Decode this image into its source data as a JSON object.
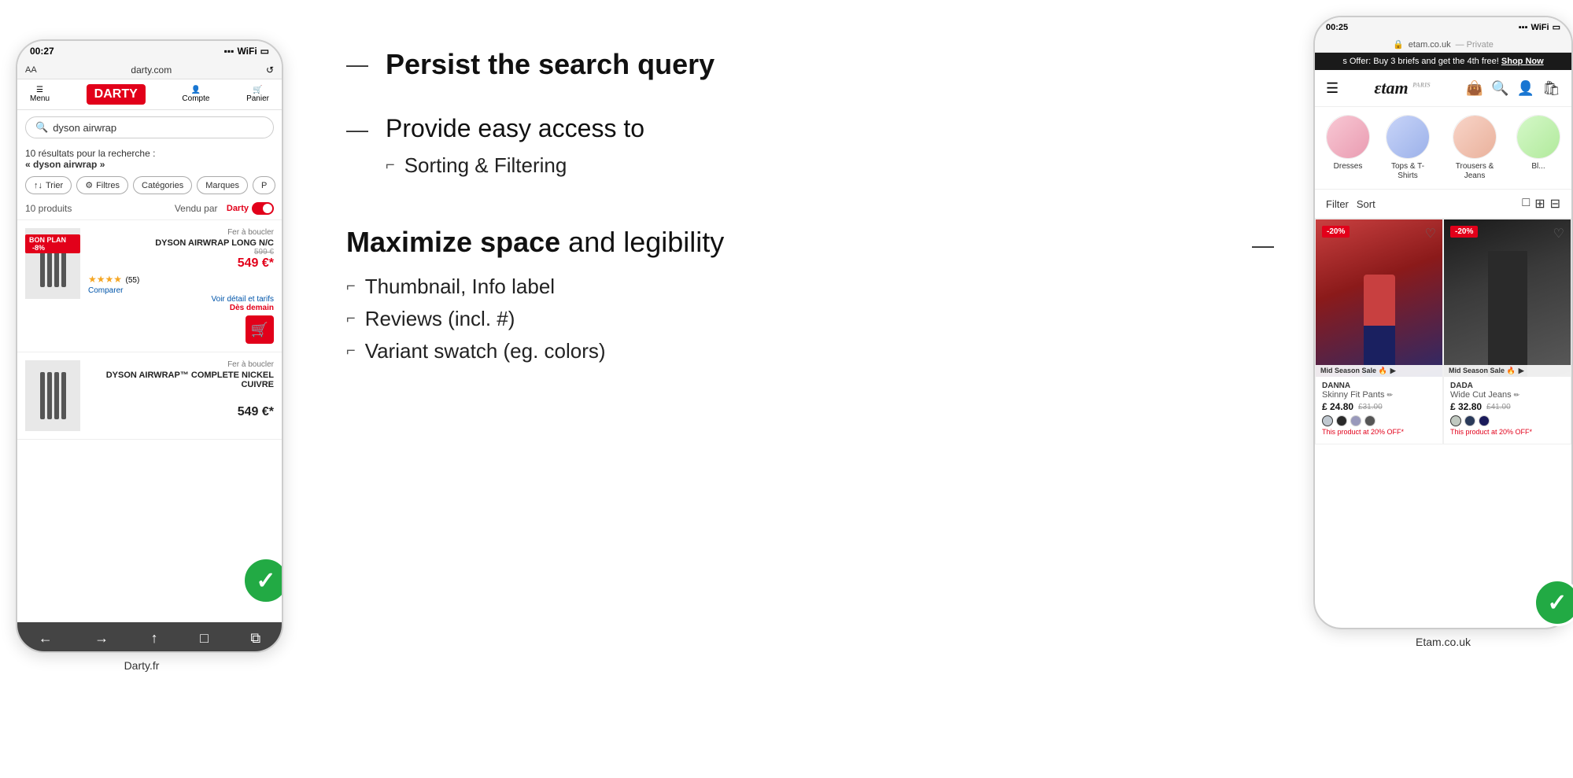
{
  "left_phone": {
    "status_bar": {
      "time": "00:27",
      "icons": "signal wifi battery"
    },
    "url_bar": {
      "label": "AA",
      "url": "darty.com",
      "reload": "↺"
    },
    "nav": {
      "menu": "Menu",
      "logo": "DARTY",
      "compte": "Compte",
      "panier": "Panier"
    },
    "search_query": "dyson airwrap",
    "results_text": "10 résultats pour la recherche :",
    "results_query": "« dyson airwrap »",
    "filters": [
      "↑↓ Trier",
      "⚙ Filtres",
      "Catégories",
      "Marques",
      "P"
    ],
    "products_count": "10 produits",
    "vendu_par": "Vendu par",
    "vendu_darty": "Darty",
    "products": [
      {
        "badge": "BON PLAN",
        "discount": "-8%",
        "category": "Fer à boucler",
        "name": "DYSON AIRWRAP LONG N/C",
        "old_price": "599 €",
        "price": "549 €*",
        "stars": "★★★★",
        "reviews": "(55)",
        "compare": "Comparer",
        "voir_detail": "Voir détail et tarifs",
        "livraison": "Dès demain"
      },
      {
        "category": "Fer à boucler",
        "name": "DYSON AIRWRAP™ COMPLETE NICKEL CUIVRE",
        "price": "549 €*"
      }
    ],
    "bottom_nav": [
      "←",
      "→",
      "↑",
      "□",
      "⧉"
    ],
    "label": "Darty.fr"
  },
  "center": {
    "bullet1": {
      "dash": "—",
      "heading": "Persist the search query"
    },
    "bullet2": {
      "dash": "—",
      "heading": "Provide easy access to",
      "sub_items": [
        {
          "corner": "⌐",
          "text": "Sorting & Filtering"
        }
      ]
    },
    "bullet3": {
      "heading_bold": "Maximize space",
      "heading_normal": " and legibility",
      "dash": "—",
      "sub_items": [
        {
          "corner": "⌐",
          "text": "Thumbnail, Info label"
        },
        {
          "corner": "⌐",
          "text": "Reviews (incl. #)"
        },
        {
          "corner": "⌐",
          "text": "Variant swatch (eg. colors)"
        }
      ]
    }
  },
  "right_phone": {
    "status_bar": {
      "time": "00:25",
      "icons": "signal wifi battery"
    },
    "url_bar": {
      "url": "etam.co.uk",
      "private": "Private"
    },
    "promo_banner": "s Offer: Buy 3 briefs and get the 4th free!",
    "promo_link": "Shop Now",
    "nav": {
      "logo": "Etam",
      "icons": [
        "☰",
        "☆",
        "♀",
        "🛍"
      ]
    },
    "categories": [
      {
        "label": "Dresses"
      },
      {
        "label": "Tops & T-Shirts"
      },
      {
        "label": "Trousers & Jeans"
      },
      {
        "label": "Bl..."
      }
    ],
    "filter_bar": {
      "filter": "Filter",
      "sort": "Sort",
      "view_icons": [
        "□",
        "⊞",
        "⊟"
      ]
    },
    "products": [
      {
        "discount": "-20%",
        "brand": "DANNA",
        "title": "Skinny Fit Pants",
        "price": "£ 24.80",
        "old_price": "£31.00",
        "sale_label": "Mid Season Sale 🔥",
        "off_text": "This product at 20% OFF*",
        "swatches": [
          "#c0c8d0",
          "#2a2a2a",
          "#9999bb",
          "#555555"
        ]
      },
      {
        "discount": "-20%",
        "brand": "DADA",
        "title": "Wide Cut Jeans",
        "price": "£ 32.80",
        "old_price": "£41.00",
        "sale_label": "Mid Season Sale 🔥",
        "off_text": "This product at 20% OFF*",
        "swatches": [
          "#c0c8c0",
          "#2a3a5a",
          "#1a1a5a"
        ]
      }
    ],
    "label": "Etam.co.uk"
  }
}
